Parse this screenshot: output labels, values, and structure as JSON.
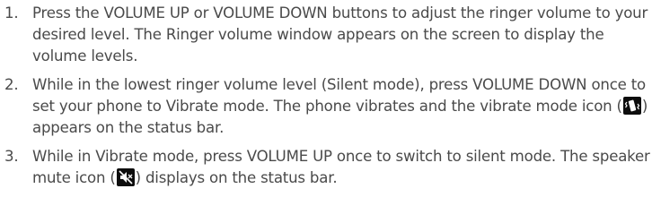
{
  "steps": [
    {
      "number": "1.",
      "text": "Press the VOLUME UP or VOLUME DOWN buttons to adjust the ringer volume to your desired level. The Ringer volume window appears on the screen to display the volume levels."
    },
    {
      "number": "2.",
      "text_before_icon": "While in the lowest ringer volume level (Silent mode), press VOLUME DOWN once to set your phone to Vibrate mode. The phone vibrates and the vibrate mode icon (",
      "icon": "vibrate-mode-icon",
      "text_after_icon": ") appears on the status bar."
    },
    {
      "number": "3.",
      "text_before_icon": "While in Vibrate mode, press VOLUME UP once to switch to silent mode. The speaker mute icon (",
      "icon": "speaker-mute-icon",
      "text_after_icon": ") displays on the status bar."
    }
  ],
  "colors": {
    "text": "#4a4a4a",
    "icon_background": "#0d0d0d",
    "icon_foreground": "#ffffff"
  }
}
